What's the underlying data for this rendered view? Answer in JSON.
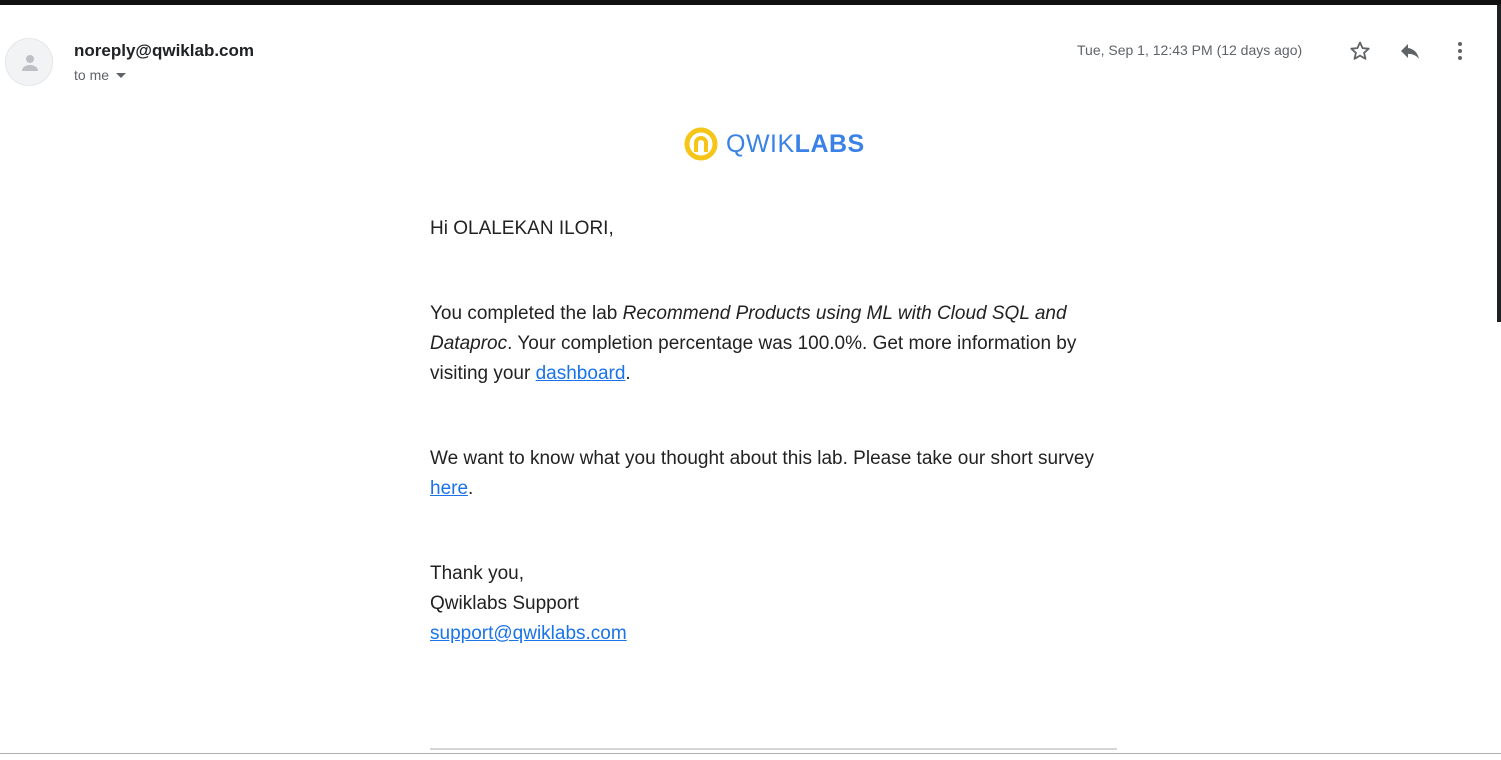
{
  "email": {
    "sender": "noreply@qwiklab.com",
    "recipient_line": "to me",
    "timestamp": "Tue, Sep 1, 12:43 PM (12 days ago)",
    "icons": {
      "avatar": "person-icon",
      "star": "star-icon",
      "reply": "reply-icon",
      "more": "more-vert-icon",
      "recipient_dropdown": "caret-down-icon"
    }
  },
  "logo": {
    "part1": "QWIK",
    "part2": "LABS",
    "brand_color": "#3b82e6",
    "mark_color": "#f5c518"
  },
  "body": {
    "greeting": "Hi OLALEKAN ILORI,",
    "p1_prefix": "You completed the lab ",
    "lab_title": "Recommend Products using ML with Cloud SQL and Dataproc",
    "p1_mid": ". Your completion percentage was 100.0%. Get more information by visiting your ",
    "dashboard_link": "dashboard",
    "p1_suffix": ".",
    "p2_prefix": "We want to know what you thought about this lab. Please take our short survey ",
    "survey_link": "here",
    "p2_suffix": ".",
    "thanks": "Thank you,",
    "signature": "Qwiklabs Support",
    "support_email": "support@qwiklabs.com",
    "link_color": "#1a73e8"
  }
}
